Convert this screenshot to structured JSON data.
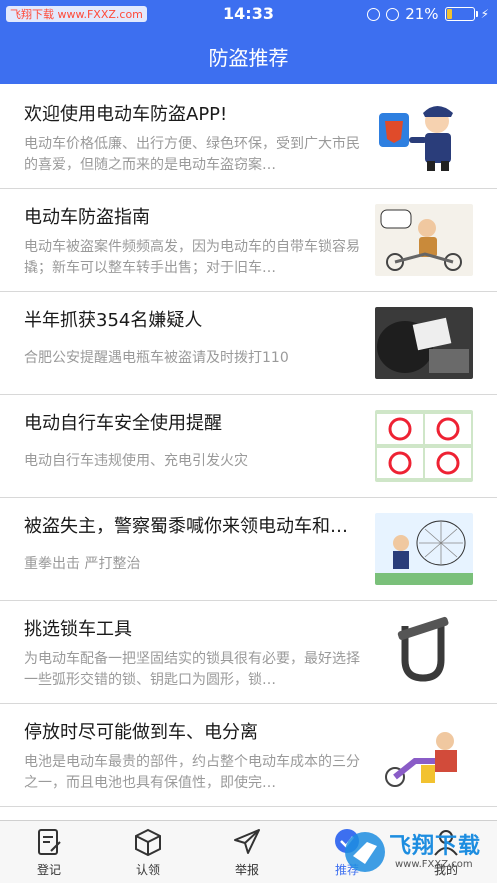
{
  "status": {
    "watermark": "飞翔下载 www.FXXZ.com",
    "time": "14:33",
    "battery": "21%",
    "battery_level": 0.21
  },
  "nav": {
    "title": "防盗推荐"
  },
  "articles": [
    {
      "title": "欢迎使用电动车防盗APP!",
      "desc": "电动车价格低廉、出行方便、绿色环保，受到广大市民的喜爱，但随之而来的是电动车盗窃案…",
      "thumb": "police-cartoon-image"
    },
    {
      "title": "电动车防盗指南",
      "desc": "电动车被盗案件频频高发，因为电动车的自带车锁容易撬；新车可以整车转手出售；对于旧车…",
      "thumb": "thief-cartoon-image"
    },
    {
      "title": "半年抓获354名嫌疑人",
      "desc": "合肥公安提醒遇电瓶车被盗请及时拨打110",
      "thumb": "scooter-photo-image"
    },
    {
      "title": "电动自行车安全使用提醒",
      "desc": "电动自行车违规使用、充电引发火灾",
      "thumb": "safety-poster-image"
    },
    {
      "title": "被盗失主，警察蜀黍喊你来领电动车和…",
      "desc": "重拳出击 严打整治",
      "thumb": "police-net-cartoon-image"
    },
    {
      "title": "挑选锁车工具",
      "desc": "为电动车配备一把坚固结实的锁具很有必要，最好选择一些弧形交错的锁、钥匙口为圆形，锁…",
      "thumb": "u-lock-image"
    },
    {
      "title": "停放时尽可能做到车、电分离",
      "desc": "电池是电动车最贵的部件，约占整个电动车成本的三分之一，而且电池也具有保值性，即使完…",
      "thumb": "battery-thief-cartoon-image"
    }
  ],
  "tabs": [
    {
      "label": "登记",
      "icon": "register-icon",
      "active": false
    },
    {
      "label": "认领",
      "icon": "box-icon",
      "active": false
    },
    {
      "label": "举报",
      "icon": "send-icon",
      "active": false
    },
    {
      "label": "推荐",
      "icon": "recommend-icon",
      "active": true
    },
    {
      "label": "我的",
      "icon": "profile-icon",
      "active": false
    }
  ],
  "site_watermark": {
    "text": "飞翔下载",
    "url": "www.FXXZ.com"
  },
  "colors": {
    "primary": "#3d6ff0",
    "battery": "#f2c230"
  }
}
